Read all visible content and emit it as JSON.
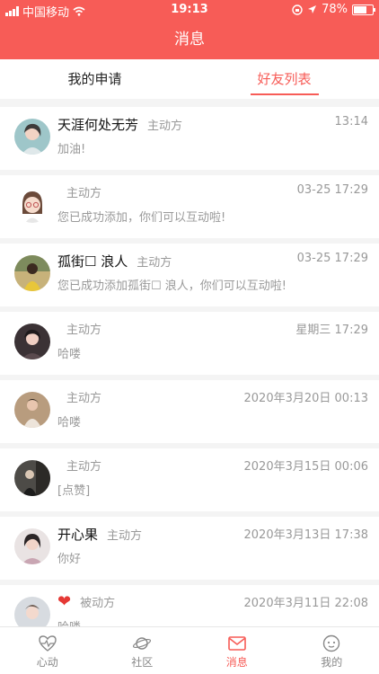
{
  "status_bar": {
    "carrier": "中国移动",
    "time": "19:13",
    "battery_text": "78%",
    "battery_level": 0.78
  },
  "navbar": {
    "title": "消息"
  },
  "tabs": [
    {
      "label": "我的申请"
    },
    {
      "label": "好友列表"
    }
  ],
  "conversations": [
    {
      "name": "天涯何处无芳",
      "role": "主动方",
      "message": "加油!",
      "time": "13:14"
    },
    {
      "name": "",
      "role": "主动方",
      "message": "您已成功添加，你们可以互动啦!",
      "time": "03-25 17:29"
    },
    {
      "name": "孤街☐ 浪人",
      "role": "主动方",
      "message": "您已成功添加孤街☐ 浪人，你们可以互动啦!",
      "time": "03-25 17:29"
    },
    {
      "name": "",
      "role": "主动方",
      "message": "哈喽",
      "time": "星期三 17:29"
    },
    {
      "name": "",
      "role": "主动方",
      "message": "哈喽",
      "time": "2020年3月20日 00:13"
    },
    {
      "name": "",
      "role": "主动方",
      "message": "[点赞]",
      "time": "2020年3月15日 00:06"
    },
    {
      "name": "开心果",
      "role": "主动方",
      "message": "你好",
      "time": "2020年3月13日 17:38"
    },
    {
      "name": "",
      "role": "被动方",
      "message": "哈喽",
      "time": "2020年3月11日 22:08",
      "name_icon": "heart-icon"
    }
  ],
  "tabbar": [
    {
      "label": "心动",
      "icon": "heartbeat-icon"
    },
    {
      "label": "社区",
      "icon": "planet-icon"
    },
    {
      "label": "消息",
      "icon": "message-icon"
    },
    {
      "label": "我的",
      "icon": "profile-face-icon"
    }
  ],
  "colors": {
    "accent": "#f75c57",
    "muted": "#999999"
  }
}
